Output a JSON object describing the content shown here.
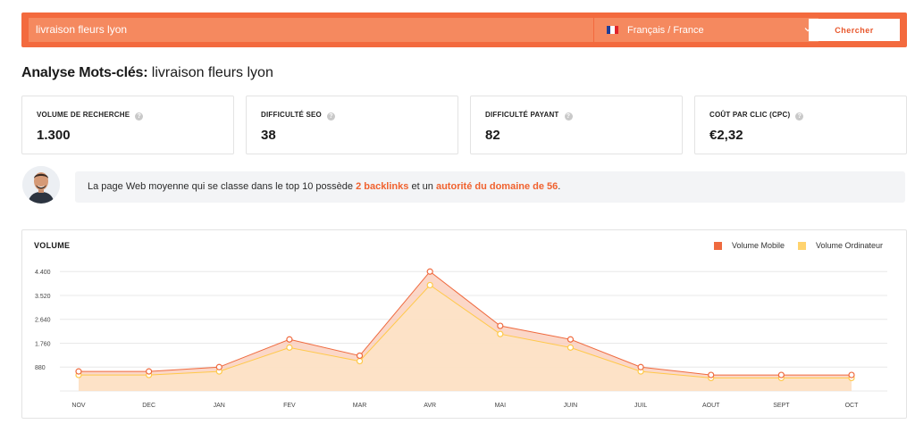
{
  "search": {
    "query": "livraison fleurs lyon",
    "language": "Français / France",
    "button_label": "Chercher"
  },
  "title": {
    "prefix": "Analyse Mots-clés:",
    "keyword": "livraison fleurs lyon"
  },
  "metrics": [
    {
      "label": "VOLUME DE RECHERCHE",
      "value": "1.300"
    },
    {
      "label": "DIFFICULTÉ SEO",
      "value": "38"
    },
    {
      "label": "DIFFICULTÉ PAYANT",
      "value": "82"
    },
    {
      "label": "COÛT PAR CLIC (CPC)",
      "value": "€2,32"
    }
  ],
  "tip": {
    "part1": "La page Web moyenne qui se classe dans le top 10 possède ",
    "backlinks": "2 backlinks",
    "part2": " et un ",
    "authority": "autorité du domaine de 56",
    "part3": "."
  },
  "colors": {
    "brand": "#f36a3e",
    "mobile": "#ef6a3f",
    "desktop": "#ffd36e"
  },
  "chart_data": {
    "type": "area",
    "title": "VOLUME",
    "categories": [
      "NOV",
      "DEC",
      "JAN",
      "FEV",
      "MAR",
      "AVR",
      "MAI",
      "JUIN",
      "JUIL",
      "AOUT",
      "SEPT",
      "OCT"
    ],
    "y_ticks": [
      "880",
      "1.760",
      "2.640",
      "3.520",
      "4.400"
    ],
    "ylim": [
      0,
      5000
    ],
    "grid": true,
    "legend_position": "top-right",
    "series": [
      {
        "name": "Volume Mobile",
        "values": [
          720,
          720,
          880,
          1900,
          1300,
          4400,
          2400,
          1900,
          880,
          590,
          590,
          590
        ]
      },
      {
        "name": "Volume Ordinateur",
        "values": [
          590,
          590,
          720,
          1600,
          1100,
          3900,
          2100,
          1600,
          720,
          480,
          480,
          480
        ]
      }
    ]
  }
}
